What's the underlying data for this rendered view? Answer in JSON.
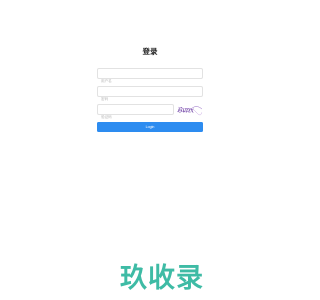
{
  "login": {
    "title": "登录",
    "username_placeholder": "用户名",
    "password_placeholder": "密码",
    "captcha_placeholder": "验证码",
    "captcha_text": "6vnx",
    "submit_label": "Login"
  },
  "watermark": {
    "text": "玖收录",
    "color": "#3ebba5"
  },
  "colors": {
    "accent": "#2d8cf0",
    "captcha_ink": "#6b3fa0"
  }
}
